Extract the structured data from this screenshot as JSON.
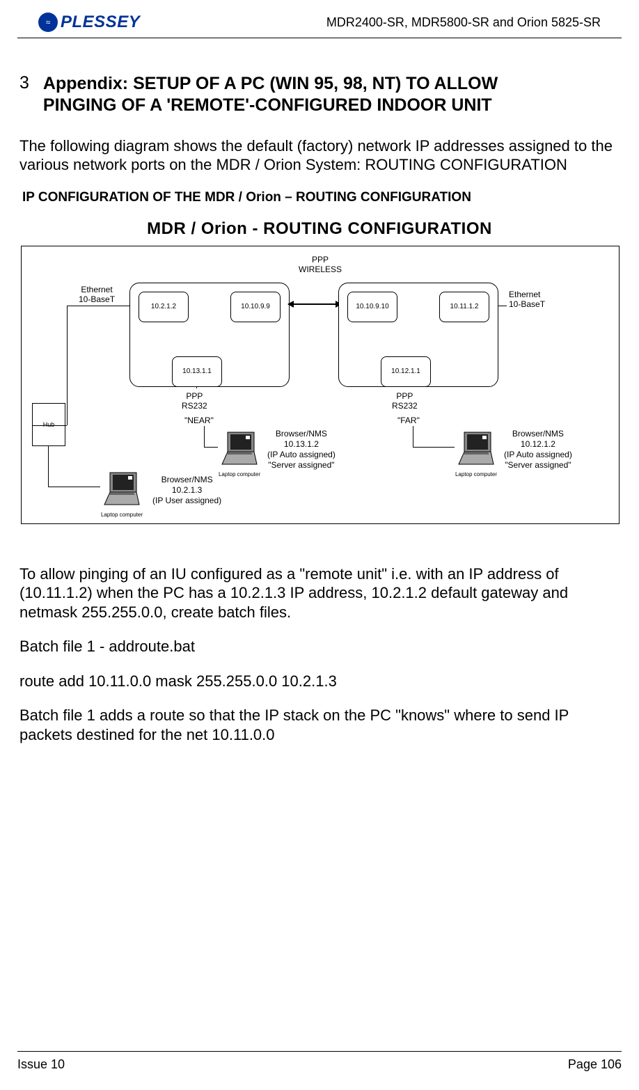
{
  "header": {
    "logo_symbol": "≈",
    "logo": "PLESSEY",
    "doc_ref": "MDR2400-SR, MDR5800-SR and Orion 5825-SR"
  },
  "appendix": {
    "number": "3",
    "title_line1": "Appendix: SETUP OF A PC (WIN 95, 98, NT) TO ALLOW",
    "title_line2": "PINGING OF A 'REMOTE'-CONFIGURED INDOOR UNIT"
  },
  "intro": "The following diagram shows the default (factory) network IP addresses assigned to the various network ports on the MDR / Orion System: ROUTING CONFIGURATION",
  "sub_heading": "IP CONFIGURATION OF THE MDR / Orion – ROUTING CONFIGURATION",
  "diagram": {
    "title": "MDR / Orion - ROUTING CONFIGURATION",
    "ppp_wireless_l1": "PPP",
    "ppp_wireless_l2": "WIRELESS",
    "ethernet_l1": "Ethernet",
    "ethernet_l2": "10-BaseT",
    "ip_left_eth": "10.2.1.2",
    "ip_left_wire": "10.10.9.9",
    "ip_left_serial": "10.13.1.1",
    "ip_right_wire": "10.10.9.10",
    "ip_right_eth": "10.11.1.2",
    "ip_right_serial": "10.12.1.1",
    "ppp_l1": "PPP",
    "ppp_l2": "RS232",
    "hub": "Hub",
    "near": "\"NEAR\"",
    "far": "\"FAR\"",
    "laptop_label": "Laptop computer",
    "browser_near_l1": "Browser/NMS",
    "browser_near_l2": "10.13.1.2",
    "browser_near_l3": "(IP Auto assigned)",
    "browser_near_l4": "\"Server assigned\"",
    "browser_far_l1": "Browser/NMS",
    "browser_far_l2": "10.12.1.2",
    "browser_far_l3": "(IP Auto assigned)",
    "browser_far_l4": "\"Server assigned\"",
    "browser_hub_l1": "Browser/NMS",
    "browser_hub_l2": "10.2.1.3",
    "browser_hub_l3": "(IP User assigned)"
  },
  "body": {
    "p1": "To allow pinging of an IU configured as a \"remote unit\" i.e. with an IP address of (10.11.1.2) when the PC has a 10.2.1.3 IP address, 10.2.1.2 default gateway and netmask 255.255.0.0, create batch files.",
    "p2": "Batch file 1 - addroute.bat",
    "p3": "route add 10.11.0.0 mask 255.255.0.0 10.2.1.3",
    "p4": "Batch file 1 adds a route so that the IP stack on the PC \"knows\" where to send IP packets destined for the net 10.11.0.0"
  },
  "footer": {
    "issue": "Issue 10",
    "page": "Page 106"
  }
}
